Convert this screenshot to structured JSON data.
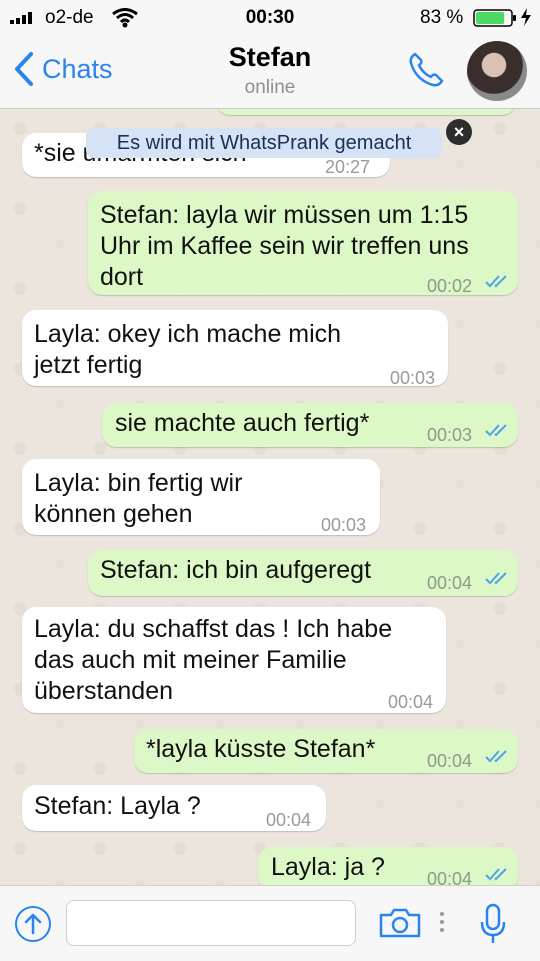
{
  "status_bar": {
    "carrier": "o2-de",
    "time": "00:30",
    "battery_percent": "83 %",
    "battery_level": 0.83
  },
  "header": {
    "back_label": "Chats",
    "contact_name": "Stefan",
    "contact_status": "online"
  },
  "banner": {
    "text": "Es wird mit WhatsPrank gemacht",
    "close_symbol": "×"
  },
  "messages": [
    {
      "direction": "in",
      "lines": [
        "*sie umarmten sich"
      ],
      "time": "20:27"
    },
    {
      "direction": "out",
      "lines": [
        "Stefan: layla wir müssen um 1:15",
        "Uhr im Kaffee sein wir treffen uns",
        "dort"
      ],
      "time": "00:02",
      "read": true
    },
    {
      "direction": "in",
      "lines": [
        "Layla: okey ich mache mich",
        "jetzt fertig"
      ],
      "time": "00:03"
    },
    {
      "direction": "out",
      "lines": [
        "sie machte auch fertig*"
      ],
      "time": "00:03",
      "read": true
    },
    {
      "direction": "in",
      "lines": [
        "Layla: bin fertig wir",
        "können gehen"
      ],
      "time": "00:03"
    },
    {
      "direction": "out",
      "lines": [
        "Stefan: ich bin aufgeregt"
      ],
      "time": "00:04",
      "read": true
    },
    {
      "direction": "in",
      "lines": [
        "Layla: du schaffst das ! Ich habe",
        "das auch mit meiner Familie",
        "überstanden"
      ],
      "time": "00:04"
    },
    {
      "direction": "out",
      "lines": [
        "*layla küsste Stefan*"
      ],
      "time": "00:04",
      "read": true
    },
    {
      "direction": "in",
      "lines": [
        "Stefan: Layla ?"
      ],
      "time": "00:04"
    },
    {
      "direction": "out",
      "lines": [
        "Layla: ja ?"
      ],
      "time": "00:04",
      "read": true
    }
  ],
  "colors": {
    "accent": "#2a84f0",
    "incoming_bubble": "#ffffff",
    "outgoing_bubble": "#dcf8c6",
    "read_ticks": "#4fa3ec",
    "chat_background": "#ece5dd"
  },
  "icons": {
    "back": "chevron-left-icon",
    "call": "phone-icon",
    "upload": "arrow-up-circle-icon",
    "camera": "camera-icon",
    "more": "more-dots-icon",
    "mic": "microphone-icon"
  }
}
